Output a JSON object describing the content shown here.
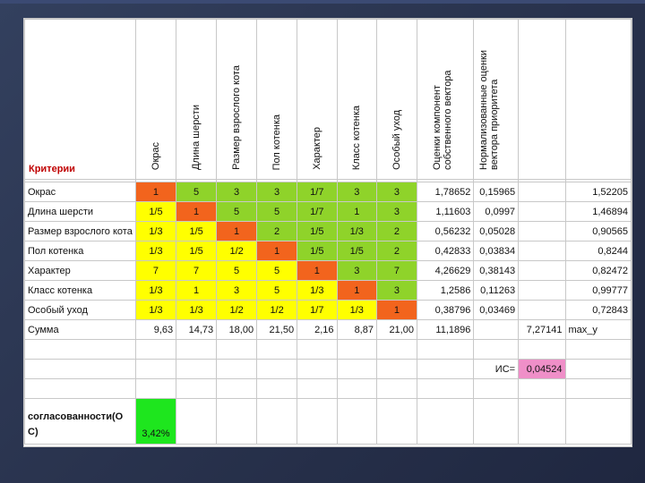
{
  "sheet": {
    "header_criteria": "Критерии",
    "headers": [
      "Окрас",
      "Длина шерсти",
      "Размер взрослого кота",
      "Пол котенка",
      "Характер",
      "Класс котенка",
      "Особый уход",
      "Оценки компонент собственного вектора",
      "Нормализованные оценки вектора приоритета"
    ],
    "rows": [
      {
        "label": "Окрас",
        "cells": [
          "1",
          "5",
          "3",
          "3",
          "1/7",
          "3",
          "3"
        ],
        "eig": "1,78652",
        "norm": "0,15965",
        "res": "1,52205"
      },
      {
        "label": "Длина шерсти",
        "cells": [
          "1/5",
          "1",
          "5",
          "5",
          "1/7",
          "1",
          "3"
        ],
        "eig": "1,11603",
        "norm": "0,0997",
        "res": "1,46894"
      },
      {
        "label": "Размер взрослого кота",
        "cells": [
          "1/3",
          "1/5",
          "1",
          "2",
          "1/5",
          "1/3",
          "2"
        ],
        "eig": "0,56232",
        "norm": "0,05028",
        "res": "0,90565"
      },
      {
        "label": "Пол котенка",
        "cells": [
          "1/3",
          "1/5",
          "1/2",
          "1",
          "1/5",
          "1/5",
          "2"
        ],
        "eig": "0,42833",
        "norm": "0,03834",
        "res": "0,8244"
      },
      {
        "label": "Характер",
        "cells": [
          "7",
          "7",
          "5",
          "5",
          "1",
          "3",
          "7"
        ],
        "eig": "4,26629",
        "norm": "0,38143",
        "res": "0,82472"
      },
      {
        "label": "Класс котенка",
        "cells": [
          "1/3",
          "1",
          "3",
          "5",
          "1/3",
          "1",
          "3"
        ],
        "eig": "1,2586",
        "norm": "0,11263",
        "res": "0,99777"
      },
      {
        "label": "Особый уход",
        "cells": [
          "1/3",
          "1/3",
          "1/2",
          "1/2",
          "1/7",
          "1/3",
          "1"
        ],
        "eig": "0,38796",
        "norm": "0,03469",
        "res": "0,72843"
      }
    ],
    "sum": {
      "label": "Сумма",
      "cells": [
        "9,63",
        "14,73",
        "18,00",
        "21,50",
        "2,16",
        "8,87",
        "21,00"
      ],
      "eig": "11,1896",
      "lambda": "7,27141",
      "lambda_label": "max_y"
    },
    "ic_label": "ИС=",
    "ic_value": "0,04524",
    "consistency_label_line1": "согласованности(О",
    "consistency_label_line2": "С)",
    "consistency_value": "3,42%"
  },
  "colors": {
    "yellow": "#ffff00",
    "green": "#8fd32a",
    "orange": "#f2641d",
    "pink": "#ef8fc8",
    "bright_green": "#1ee61e",
    "criteria_red": "#c00000",
    "slide_background": "#2a344f"
  }
}
